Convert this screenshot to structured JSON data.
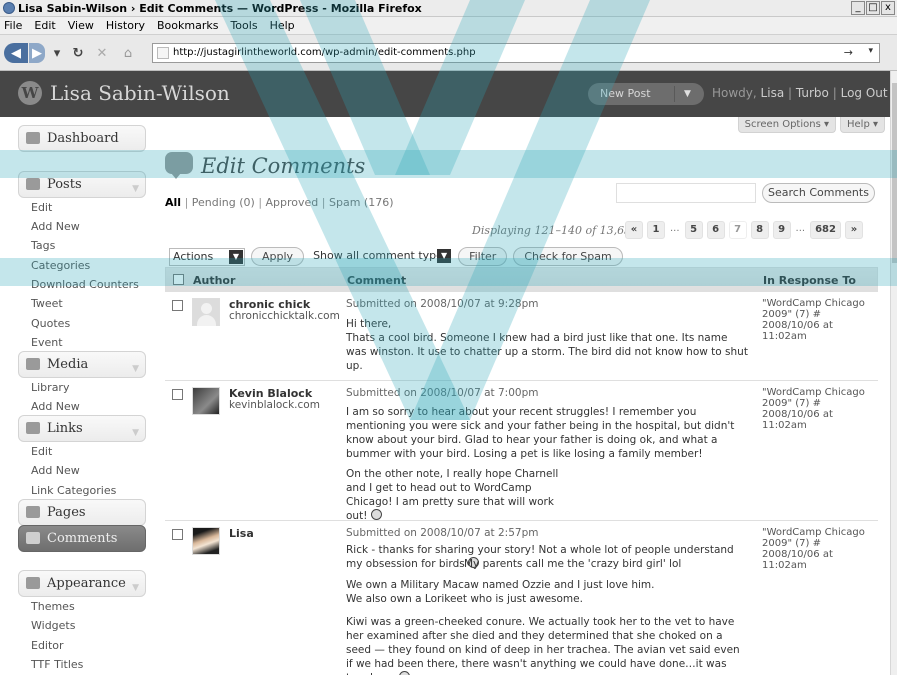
{
  "window": {
    "title": "Lisa Sabin-Wilson › Edit Comments — WordPress - Mozilla Firefox",
    "buttons": [
      "_",
      "□",
      "x"
    ]
  },
  "menubar": [
    "File",
    "Edit",
    "View",
    "History",
    "Bookmarks",
    "Tools",
    "Help"
  ],
  "browser": {
    "url": "http://justagirlintheworld.com/wp-admin/edit-comments.php",
    "go_glyph": "→",
    "dropdown_glyph": "▾"
  },
  "wpheader": {
    "logo_letter": "W",
    "site_name": "Lisa Sabin-Wilson",
    "new_post": "New Post",
    "howdy_prefix": "Howdy,",
    "user": "Lisa",
    "sep1": "|",
    "turbo": "Turbo",
    "sep2": "|",
    "logout": "Log Out"
  },
  "sidebar": {
    "dashboard": "Dashboard",
    "posts": "Posts",
    "posts_items": [
      "Edit",
      "Add New",
      "Tags",
      "Categories",
      "Download Counters",
      "Tweet",
      "Quotes",
      "Event"
    ],
    "media": "Media",
    "media_items": [
      "Library",
      "Add New"
    ],
    "links": "Links",
    "links_items": [
      "Edit",
      "Add New",
      "Link Categories"
    ],
    "pages": "Pages",
    "comments": "Comments",
    "appearance": "Appearance",
    "appearance_items": [
      "Themes",
      "Widgets",
      "Editor",
      "TTF Titles"
    ]
  },
  "screen_options": "Screen Options ▾",
  "help": "Help ▾",
  "page_title": "Edit Comments",
  "statuses": {
    "all": "All",
    "pending": "Pending (0)",
    "approved": "Approved",
    "spam": "Spam (176)"
  },
  "search": {
    "value": "",
    "button": "Search Comments"
  },
  "displaying": "Displaying 121–140 of 13,638",
  "pagination": [
    "«",
    "1",
    "...",
    "5",
    "6",
    "7",
    "8",
    "9",
    "...",
    "682",
    "»"
  ],
  "pagination_current": "7",
  "toolbar": {
    "actions": "Actions",
    "apply": "Apply",
    "comment_types": "Show all comment types",
    "filter": "Filter",
    "check_spam": "Check for Spam"
  },
  "table": {
    "columns": [
      "Author",
      "Comment",
      "In Response To"
    ],
    "rows": [
      {
        "author": "chronic chick",
        "site": "chronicchicktalk.com",
        "submitted": "Submitted on 2008/10/07 at 9:28pm",
        "paras": [
          "Hi there,",
          "Thats a cool bird. Someone I knew had a bird just like that one. Its name was winston. It use to chatter up a storm. The bird did not know how to shut up."
        ],
        "response": [
          "\"WordCamp Chicago",
          "2009\" (7) #",
          "2008/10/06 at",
          "11:02am"
        ]
      },
      {
        "author": "Kevin Blalock",
        "site": "kevinblalock.com",
        "submitted": "Submitted on 2008/10/07 at 7:00pm",
        "paras": [
          "I am so sorry to hear about your recent struggles! I remember you mentioning you were sick and your father being in the hospital, but didn't know about your bird. Glad to hear your father is doing ok, and what a bummer with your bird. Losing a pet is like losing a family member!",
          "On the other note, I really hope Charnell and I get to head out to WordCamp Chicago! I am pretty sure that will work out!"
        ],
        "response": [
          "\"WordCamp Chicago",
          "2009\" (7) #",
          "2008/10/06 at",
          "11:02am"
        ]
      },
      {
        "author": "Lisa",
        "site": "",
        "submitted": "Submitted on 2008/10/07 at 2:57pm",
        "paras": [
          "Rick - thanks for sharing your story! Not a whole lot of people understand my obsession for birds",
          "My parents call me the 'crazy bird girl' lol",
          "We own a Military Macaw named Ozzie and I just love him.",
          "We also own a Lorikeet who is just awesome.",
          "Kiwi was a green-cheeked conure. We actually took her to the vet to have her examined after she died and they determined that she choked on a seed — they found on kind of deep in her trachea. The avian vet said even if we had been there, there wasn't anything we could have done…it was too deep."
        ],
        "response": [
          "\"WordCamp Chicago",
          "2009\" (7) #",
          "2008/10/06 at",
          "11:02am"
        ]
      }
    ]
  },
  "colors": {
    "header": "#464646",
    "watermark": "#2aa7b8"
  }
}
